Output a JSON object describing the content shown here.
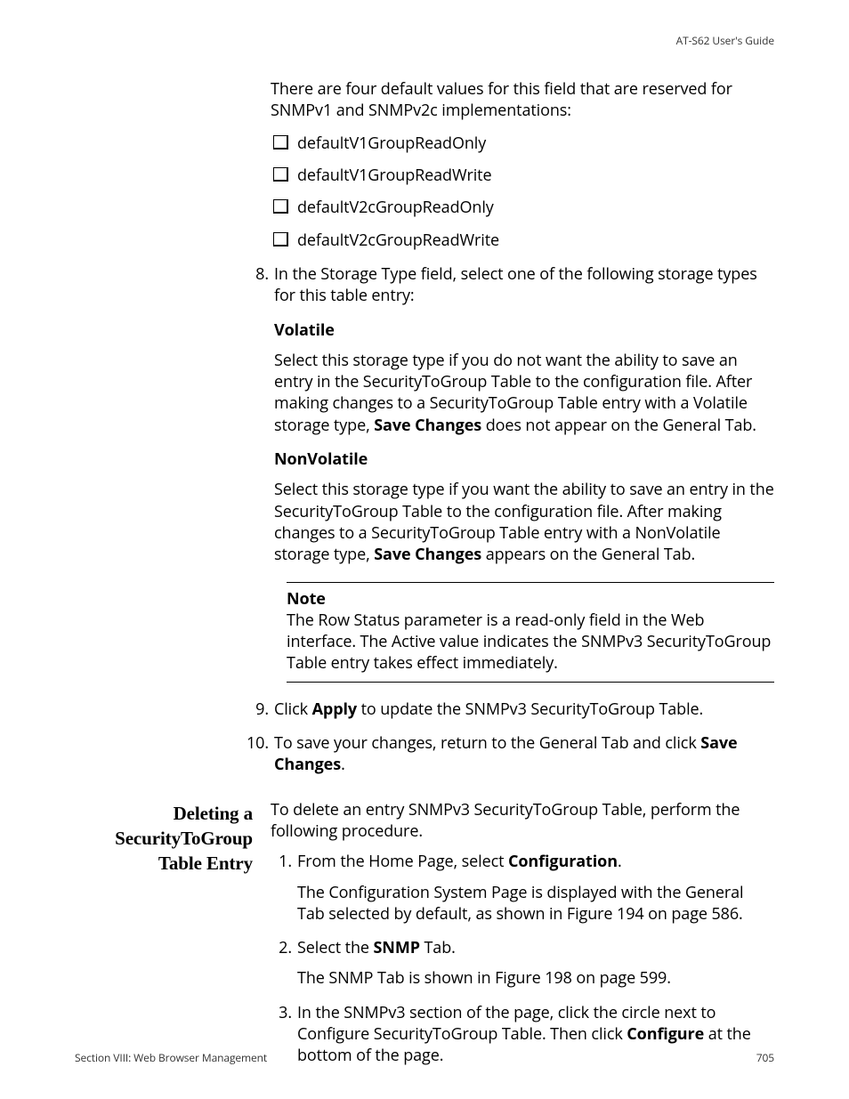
{
  "header": {
    "guide": "AT-S62  User's Guide"
  },
  "intro": "There are four default values for this field that are reserved for SNMPv1 and SNMPv2c implementations:",
  "defaults": [
    "defaultV1GroupReadOnly",
    "defaultV1GroupReadWrite",
    "defaultV2cGroupReadOnly",
    "defaultV2cGroupReadWrite"
  ],
  "steps_a": {
    "n8": {
      "num": "8.",
      "text": "In the Storage Type field, select one of the following storage types for this table entry:"
    },
    "volatile": {
      "title": "Volatile",
      "t1": "Select this storage type if you do not want the ability to save an entry in the SecurityToGroup Table to the configuration file. After making changes to a SecurityToGroup Table entry with a Volatile storage type, ",
      "b1": "Save Changes",
      "t2": " does not appear on the General Tab."
    },
    "nonvolatile": {
      "title": "NonVolatile",
      "t1": "Select this storage type if you want the ability to save an entry in the SecurityToGroup Table to the configuration file. After making changes to a SecurityToGroup Table entry with a NonVolatile storage type, ",
      "b1": "Save Changes",
      "t2": " appears on the General Tab."
    },
    "note": {
      "title": "Note",
      "text": "The Row Status parameter is a read-only field in the Web interface. The Active value indicates the SNMPv3 SecurityToGroup Table entry takes effect immediately."
    },
    "n9": {
      "num": "9.",
      "t1": "Click ",
      "b1": "Apply",
      "t2": " to update the SNMPv3 SecurityToGroup Table."
    },
    "n10": {
      "num": "10.",
      "t1": "To save your changes, return to the General Tab and click ",
      "b1": "Save Changes",
      "t2": "."
    }
  },
  "section": {
    "heading": "Deleting a SecurityToGroup Table Entry",
    "intro": "To delete an entry SNMPv3 SecurityToGroup Table, perform the following procedure.",
    "n1": {
      "num": "1.",
      "t1": "From the Home Page, select ",
      "b1": "Configuration",
      "t2": ".",
      "sub": "The Configuration System Page is displayed with the General Tab selected by default, as shown in Figure 194 on page 586."
    },
    "n2": {
      "num": "2.",
      "t1": "Select the ",
      "b1": "SNMP",
      "t2": " Tab.",
      "sub": "The SNMP Tab is shown in Figure 198 on page 599."
    },
    "n3": {
      "num": "3.",
      "t1": "In the SNMPv3 section of the page, click the circle next to Configure SecurityToGroup Table. Then click ",
      "b1": "Configure",
      "t2": " at the bottom of the page."
    }
  },
  "footer": {
    "left": "Section VIII: Web Browser Management",
    "right": "705"
  }
}
